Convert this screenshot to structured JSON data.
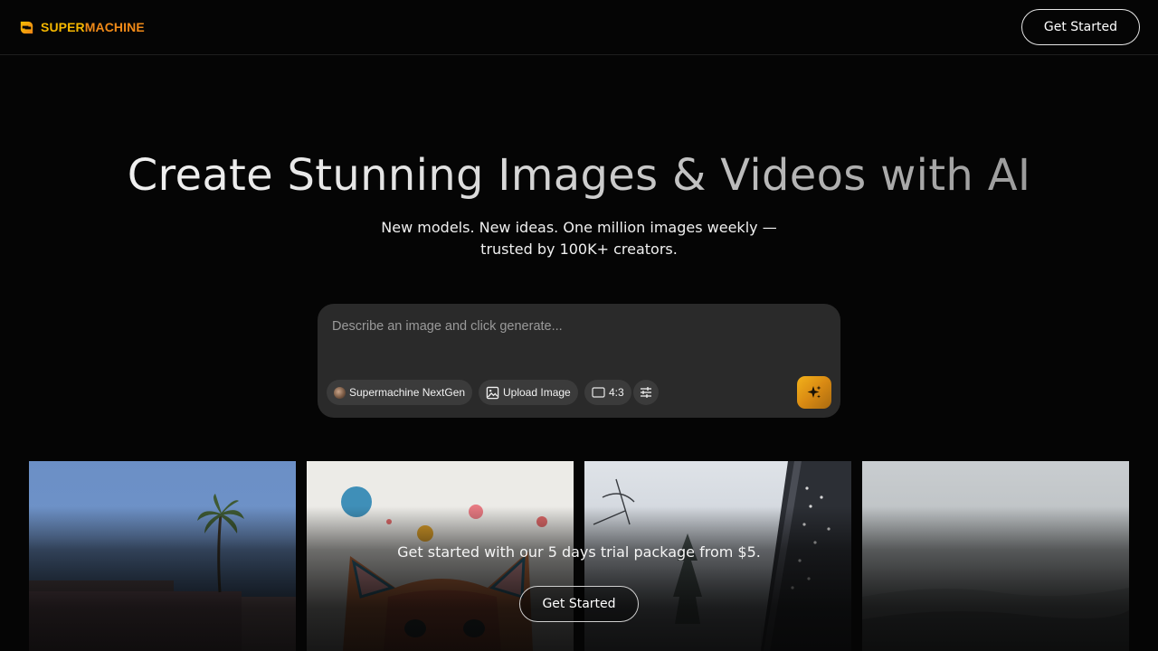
{
  "header": {
    "logo_text_part1": "SUPER",
    "logo_text_part2": "MACHINE",
    "logo_icon": "supermachine-logo-icon",
    "cta_label": "Get Started"
  },
  "hero": {
    "title": "Create Stunning Images & Videos with AI",
    "subtitle": "New models. New ideas. One million images weekly — trusted by 100K+ creators."
  },
  "prompt": {
    "placeholder": "Describe an image and click generate...",
    "model_label": "Supermachine NextGen",
    "upload_label": "Upload Image",
    "upload_icon": "image-icon",
    "ratio_label": "4:3",
    "ratio_icon": "aspect-ratio-icon",
    "settings_icon": "sliders-icon",
    "generate_icon": "sparkle-icon"
  },
  "gallery": {
    "tiles": [
      "palm-tree-sky",
      "watercolor-cat",
      "snowy-building",
      "misty-landscape"
    ]
  },
  "trial": {
    "text": "Get started with our 5 days trial package from $5.",
    "cta_label": "Get Started"
  },
  "colors": {
    "brand_yellow": "#f5b700",
    "brand_orange": "#f08a18",
    "background": "#050505",
    "prompt_bg": "#2a2a2a",
    "chip_bg": "#3b3b3b"
  }
}
